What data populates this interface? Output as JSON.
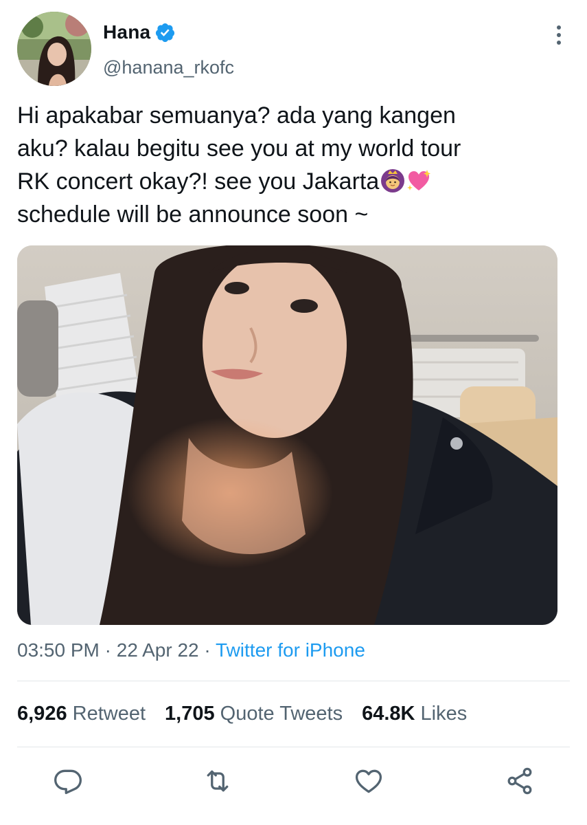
{
  "author": {
    "display_name": "Hana",
    "handle": "@hanana_rkofc",
    "verified_icon": "verified-badge-icon",
    "avatar_icon": "profile-photo"
  },
  "tweet": {
    "text_line1": "Hi apakabar semuanya? ada yang kangen",
    "text_line2": "aku? kalau begitu see you at my world tour",
    "text_line3": "RK concert okay?! see you Jakarta",
    "text_line3_emojis": [
      "woman-with-crown-emoji",
      "sparkling-heart-emoji"
    ],
    "text_line4": "schedule will be announce soon ~",
    "media_description_icon": "selfie-photo"
  },
  "meta": {
    "time": "03:50 PM",
    "sep1": " · ",
    "date": "22 Apr 22",
    "sep2": " · ",
    "source": "Twitter for iPhone"
  },
  "stats": {
    "retweets_count": "6,926",
    "retweets_label": "Retweet",
    "quotes_count": "1,705",
    "quotes_label": "Quote Tweets",
    "likes_count": "64.8K",
    "likes_label": "Likes"
  },
  "actions": {
    "reply_icon": "reply-icon",
    "retweet_icon": "retweet-icon",
    "like_icon": "heart-icon",
    "share_icon": "share-icon"
  },
  "colors": {
    "accent": "#1d9bf0",
    "secondary_text": "#536471",
    "primary_text": "#0f1419",
    "divider": "#e2e6e9"
  }
}
